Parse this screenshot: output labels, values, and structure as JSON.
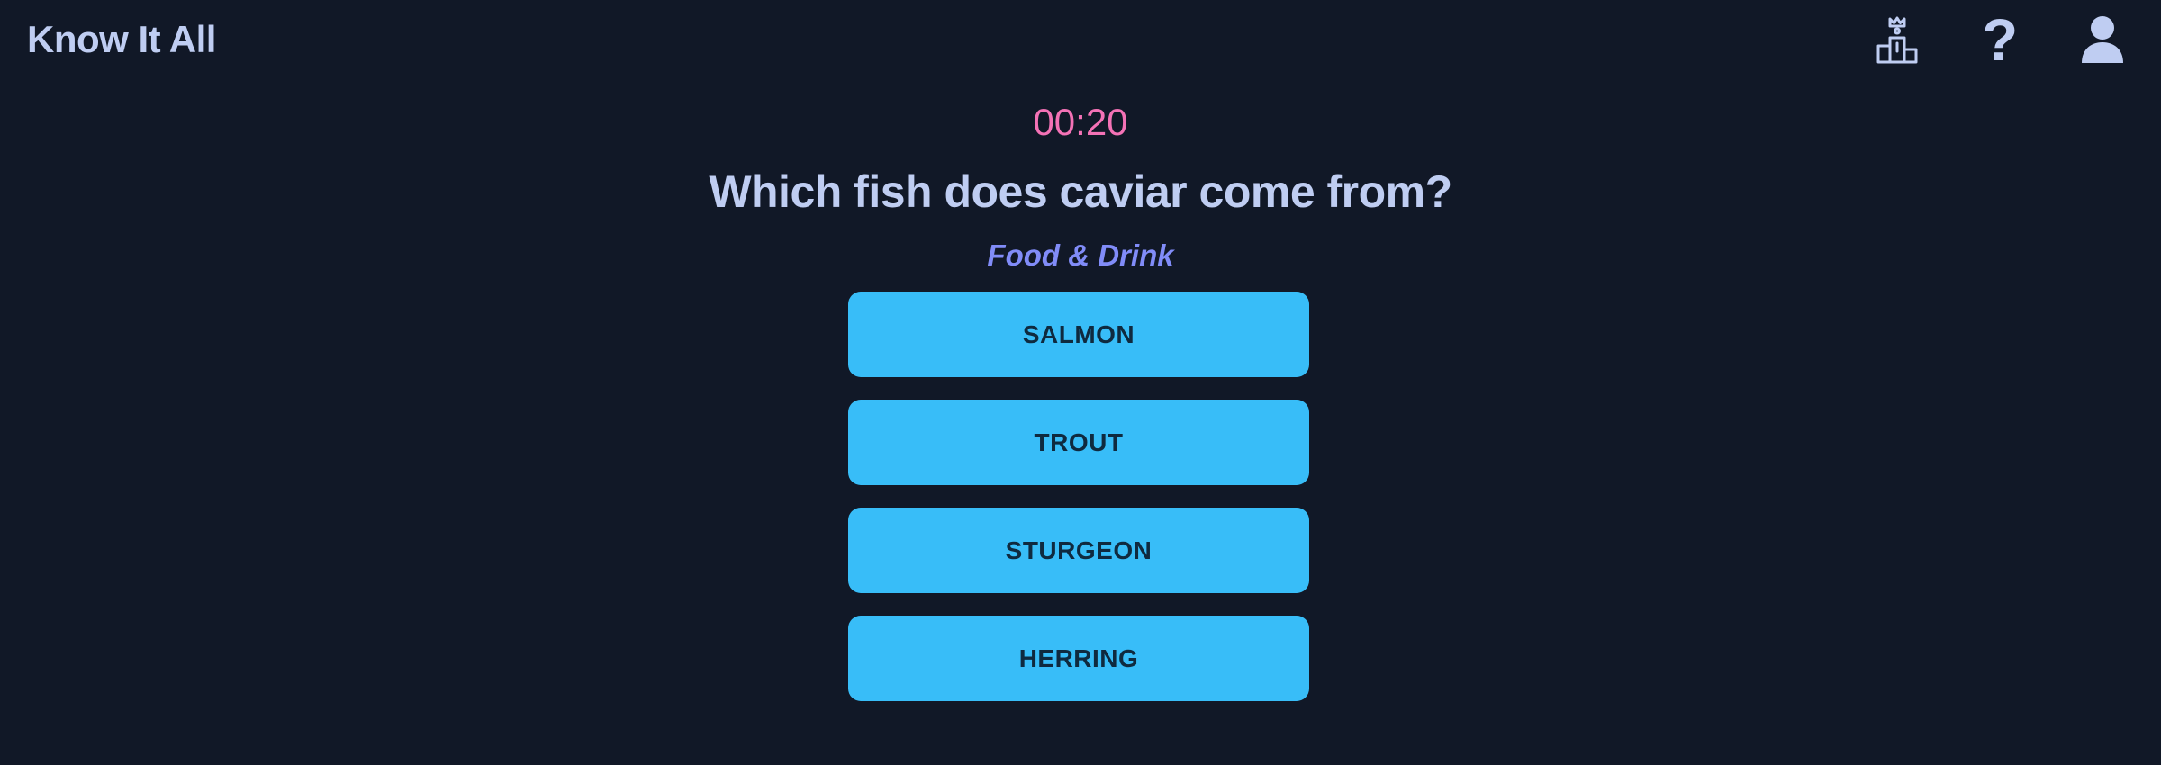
{
  "header": {
    "title": "Know It All",
    "icons": [
      "leaderboard-icon",
      "help-icon",
      "user-icon"
    ],
    "help_glyph": "?"
  },
  "game": {
    "timer": "00:20",
    "question": "Which fish does caviar come from?",
    "category": "Food & Drink",
    "answers": [
      "SALMON",
      "TROUT",
      "STURGEON",
      "HERRING"
    ]
  },
  "colors": {
    "background": "#111827",
    "text": "#bfcdf2",
    "timer": "#f472b6",
    "category": "#818cf8",
    "button": "#38bdf8",
    "button_text": "#0f2a3f"
  }
}
